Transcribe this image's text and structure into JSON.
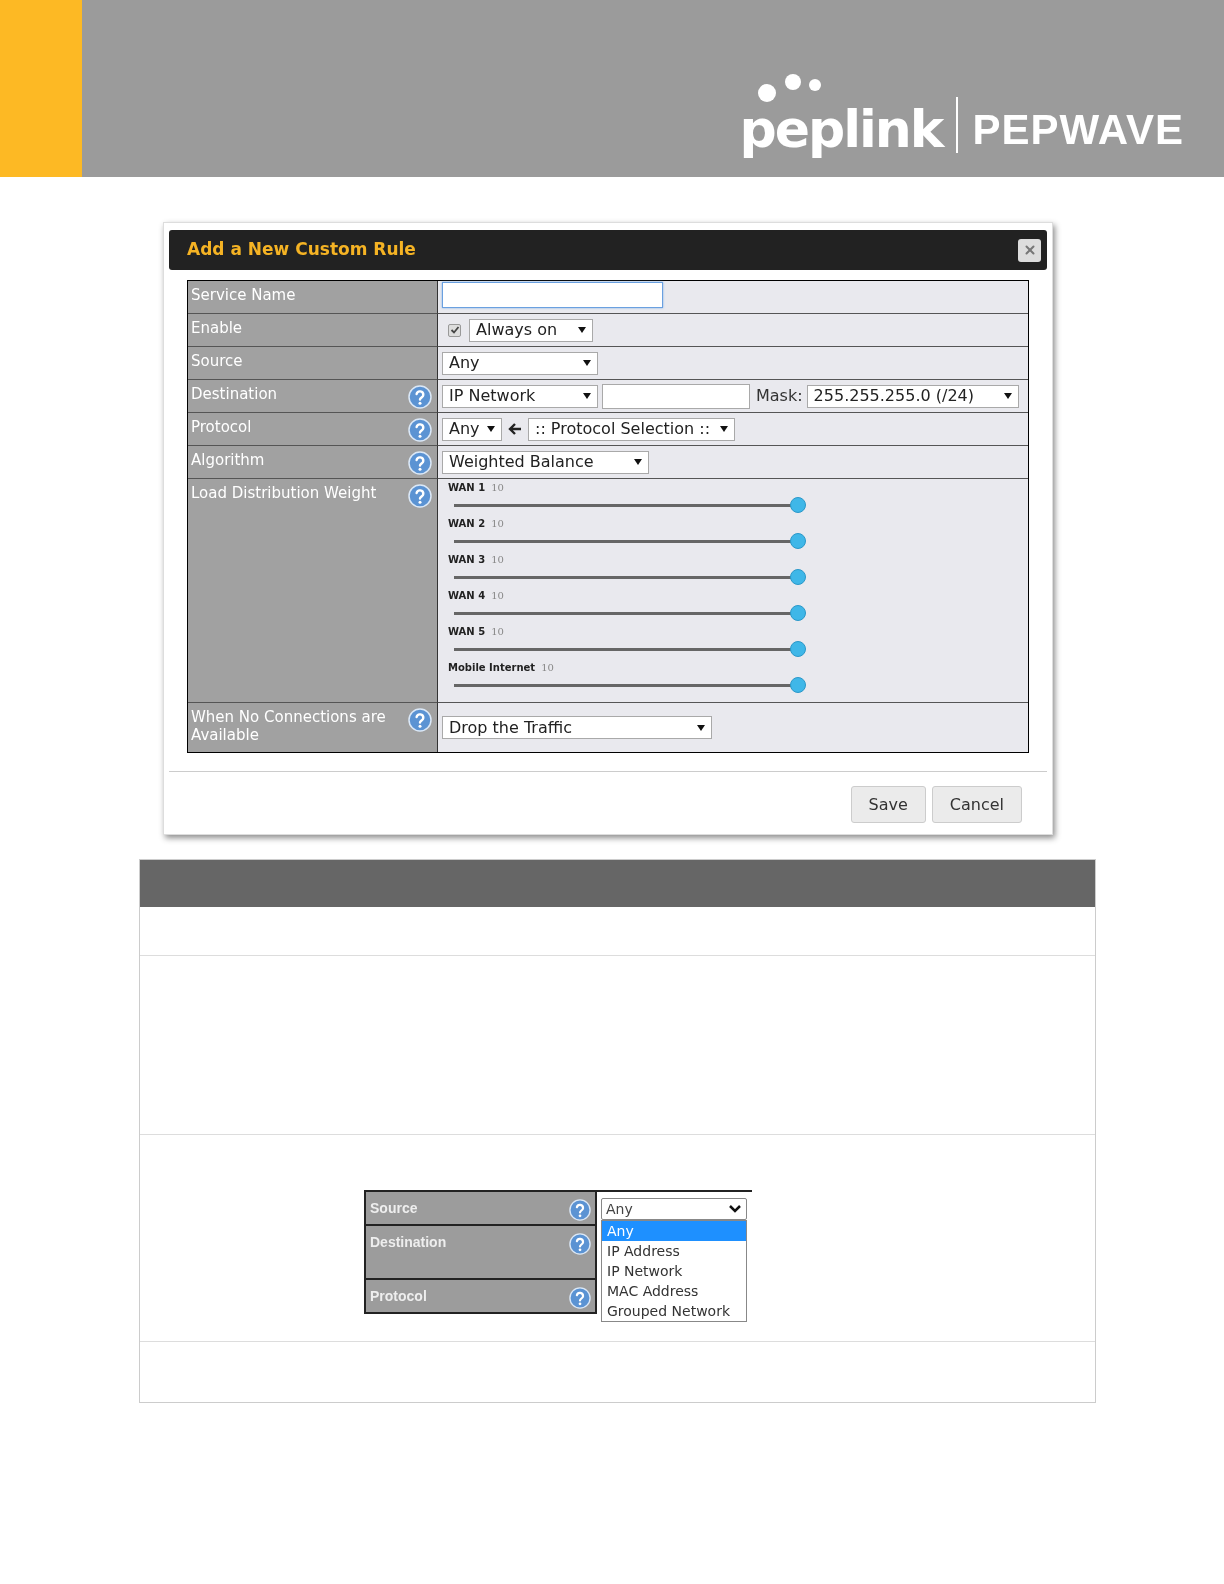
{
  "header": {
    "logo": "peplink",
    "brand": "PEPWAVE"
  },
  "dialog": {
    "title": "Add a New Custom Rule",
    "rows": [
      {
        "label": "Service Name",
        "help": false,
        "kind": "text"
      },
      {
        "label": "Enable",
        "help": false,
        "kind": "enable",
        "checked": true,
        "select": "Always on"
      },
      {
        "label": "Source",
        "help": false,
        "kind": "select",
        "select": "Any"
      },
      {
        "label": "Destination",
        "help": true,
        "kind": "destination",
        "select": "IP Network",
        "mask_label": "Mask:",
        "mask": "255.255.255.0 (/24)"
      },
      {
        "label": "Protocol",
        "help": true,
        "kind": "protocol",
        "select": "Any",
        "selection": ":: Protocol Selection ::"
      },
      {
        "label": "Algorithm",
        "help": true,
        "kind": "select",
        "select": "Weighted Balance"
      },
      {
        "label": "Load Distribution Weight",
        "help": true,
        "kind": "sliders",
        "sliders": [
          {
            "label": "WAN 1",
            "value": "10",
            "level": 1
          },
          {
            "label": "WAN 2",
            "value": "10",
            "level": 1
          },
          {
            "label": "WAN 3",
            "value": "10",
            "level": 1
          },
          {
            "label": "WAN 4",
            "value": "10",
            "level": 1
          },
          {
            "label": "WAN 5",
            "value": "10",
            "level": 1
          },
          {
            "label": "Mobile Internet",
            "value": "10",
            "level": 1
          }
        ]
      },
      {
        "label": "When No Connections are Available",
        "help": true,
        "kind": "select",
        "select": "Drop the Traffic"
      }
    ],
    "buttons": [
      "Save",
      "Cancel"
    ]
  },
  "inset": {
    "rows": [
      {
        "label": "Source",
        "help": true
      },
      {
        "label": "Destination",
        "help": true
      },
      {
        "label": "Protocol",
        "help": true
      }
    ],
    "select": "Any",
    "options": [
      {
        "label": "Any",
        "selected": true
      },
      {
        "label": "IP Address",
        "selected": false
      },
      {
        "label": "IP Network",
        "selected": false
      },
      {
        "label": "MAC Address",
        "selected": false
      },
      {
        "label": "Grouped Network",
        "selected": false
      }
    ]
  }
}
